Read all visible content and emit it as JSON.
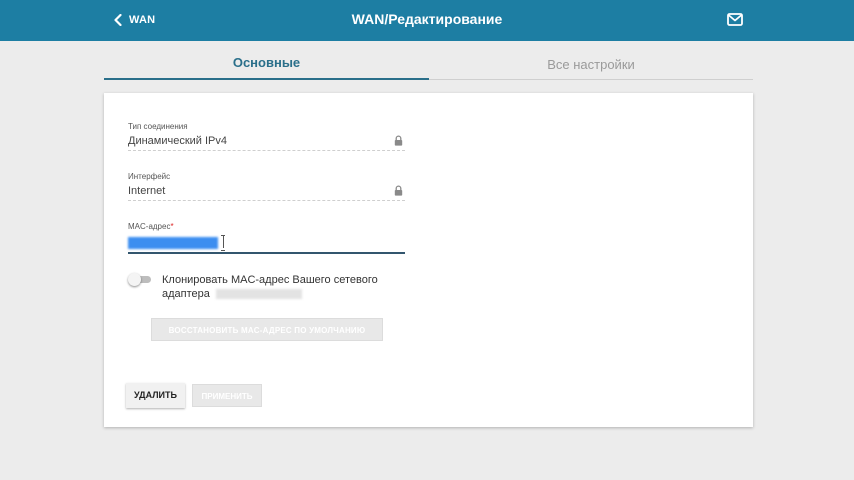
{
  "header": {
    "back_label": "WAN",
    "title": "WAN/Редактирование",
    "back_icon": "chevron-left-icon",
    "mail_icon": "mail-icon",
    "bg_color": "#1d7ea3"
  },
  "tabs": [
    {
      "label": "Основные",
      "active": true
    },
    {
      "label": "Все настройки",
      "active": false
    }
  ],
  "form": {
    "connection_type": {
      "label": "Тип соединения",
      "value": "Динамический IPv4",
      "locked": true
    },
    "interface": {
      "label": "Интерфейс",
      "value": "Internet",
      "locked": true
    },
    "mac": {
      "label": "MAC-адрес",
      "required_mark": "*",
      "value": ""
    },
    "clone": {
      "label": "Клонировать MAC-адрес Вашего сетевого адаптера",
      "adapter_mac": "",
      "enabled": false
    },
    "restore_button": "ВОССТАНОВИТЬ MAC-АДРЕС ПО УМОЛЧАНИЮ"
  },
  "actions": {
    "delete_label": "УДАЛИТЬ",
    "apply_label": "ПРИМЕНИТЬ"
  }
}
